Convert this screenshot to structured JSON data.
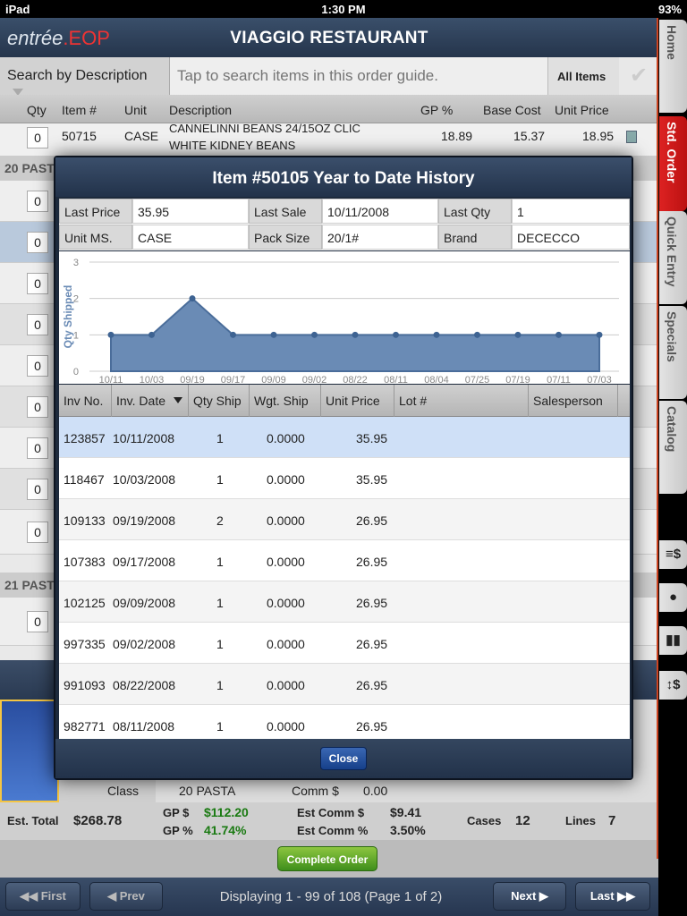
{
  "status": {
    "device": "iPad",
    "time": "1:30 PM",
    "battery": "93%"
  },
  "app": {
    "logo_main": "entrée",
    "logo_accent": ".EOP",
    "title": "VIAGGIO RESTAURANT"
  },
  "search": {
    "by_label": "Search by Description",
    "placeholder": "Tap to search items in this order guide.",
    "filter": "All Items"
  },
  "columns": {
    "qty": "Qty",
    "item": "Item #",
    "unit": "Unit",
    "description": "Description",
    "gp": "GP %",
    "base_cost": "Base Cost",
    "unit_price": "Unit Price"
  },
  "first_row": {
    "qty": "0",
    "item": "50715",
    "unit": "CASE",
    "desc1": "CANNELINNI BEANS 24/15OZ CLIC",
    "desc2": "WHITE KIDNEY BEANS",
    "gp": "18.89",
    "base": "15.37",
    "price": "18.95"
  },
  "groups": {
    "g20": "20 PAST",
    "g21": "21 PAST"
  },
  "bg_qty": "0",
  "detail": {
    "class_label": "Class",
    "class_value": "20 PASTA",
    "comm_label": "Comm $",
    "comm_value": "0.00"
  },
  "totals": {
    "est_total_label": "Est. Total",
    "est_total": "$268.78",
    "gp_dollar_label": "GP $",
    "gp_dollar": "$112.20",
    "gp_pct_label": "GP %",
    "gp_pct": "41.74%",
    "est_comm_label": "Est Comm $",
    "est_comm": "$9.41",
    "est_comm_pct_label": "Est Comm %",
    "est_comm_pct": "3.50%",
    "cases_label": "Cases",
    "cases": "12",
    "lines_label": "Lines",
    "lines": "7"
  },
  "complete_label": "Complete Order",
  "pager": {
    "first": "First",
    "prev": "Prev",
    "info": "Displaying 1 - 99 of 108 (Page 1 of 2)",
    "next": "Next",
    "last": "Last"
  },
  "sidebar": {
    "home": "Home",
    "std_order": "Std. Order",
    "quick_entry": "Quick Entry",
    "specials": "Specials",
    "catalog": "Catalog",
    "icon1": "≡$",
    "icon4": "↕$"
  },
  "modal": {
    "title": "Item #50105 Year to Date History",
    "info": {
      "last_price_label": "Last Price",
      "last_price": "35.95",
      "last_sale_label": "Last Sale",
      "last_sale": "10/11/2008",
      "last_qty_label": "Last Qty",
      "last_qty": "1",
      "unit_ms_label": "Unit MS.",
      "unit_ms": "CASE",
      "pack_size_label": "Pack Size",
      "pack_size": "20/1#",
      "brand_label": "Brand",
      "brand": "DECECCO"
    },
    "columns": {
      "inv_no": "Inv No.",
      "inv_date": "Inv. Date",
      "qty_ship": "Qty Ship",
      "wgt_ship": "Wgt. Ship",
      "unit_price": "Unit Price",
      "lot": "Lot #",
      "salesperson": "Salesperson"
    },
    "rows": [
      {
        "inv": "123857",
        "date": "10/11/2008",
        "qty": "1",
        "wgt": "0.0000",
        "price": "35.95"
      },
      {
        "inv": "118467",
        "date": "10/03/2008",
        "qty": "1",
        "wgt": "0.0000",
        "price": "35.95"
      },
      {
        "inv": "109133",
        "date": "09/19/2008",
        "qty": "2",
        "wgt": "0.0000",
        "price": "26.95"
      },
      {
        "inv": "107383",
        "date": "09/17/2008",
        "qty": "1",
        "wgt": "0.0000",
        "price": "26.95"
      },
      {
        "inv": "102125",
        "date": "09/09/2008",
        "qty": "1",
        "wgt": "0.0000",
        "price": "26.95"
      },
      {
        "inv": "997335",
        "date": "09/02/2008",
        "qty": "1",
        "wgt": "0.0000",
        "price": "26.95"
      },
      {
        "inv": "991093",
        "date": "08/22/2008",
        "qty": "1",
        "wgt": "0.0000",
        "price": "26.95"
      },
      {
        "inv": "982771",
        "date": "08/11/2008",
        "qty": "1",
        "wgt": "0.0000",
        "price": "26.95"
      }
    ],
    "close": "Close"
  },
  "chart_data": {
    "type": "area",
    "ylabel": "Qty Shipped",
    "xlabel": "",
    "categories": [
      "10/11",
      "10/03",
      "09/19",
      "09/17",
      "09/09",
      "09/02",
      "08/22",
      "08/11",
      "08/04",
      "07/25",
      "07/19",
      "07/11",
      "07/03"
    ],
    "values": [
      1,
      1,
      2,
      1,
      1,
      1,
      1,
      1,
      1,
      1,
      1,
      1,
      1
    ],
    "ylim": [
      0,
      3
    ],
    "yticks": [
      "0",
      "1",
      "2",
      "3"
    ],
    "color": "#6a8bb5"
  }
}
